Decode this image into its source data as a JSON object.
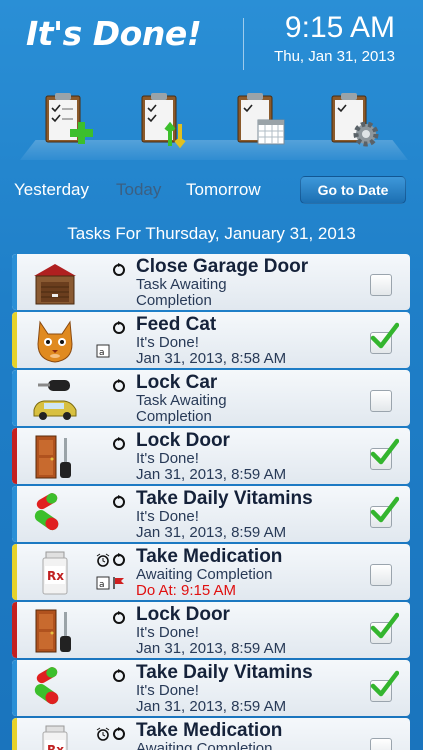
{
  "app": {
    "title": "It's Done!",
    "clock_time": "9:15 AM",
    "clock_date": "Thu, Jan 31, 2013"
  },
  "toolbar": {
    "icons": [
      "add-task-icon",
      "sort-tasks-icon",
      "calendar-tasks-icon",
      "settings-tasks-icon"
    ]
  },
  "daynav": {
    "yesterday": "Yesterday",
    "today": "Today",
    "tomorrow": "Tomorrow",
    "goto": "Go to Date"
  },
  "section_title": "Tasks For Thursday, January 31, 2013",
  "colors": {
    "accent_blue": "#2a8fd6",
    "accent_yellow": "#e6d22a",
    "accent_red": "#c42020",
    "due_red": "#e01010",
    "check_green": "#34b52e"
  },
  "tasks": [
    {
      "name": "Close Garage Door",
      "status": "Task Awaiting",
      "status2": "Completion",
      "due": "",
      "done": false,
      "accent": "#2a8fd6",
      "thumb": "garage-icon",
      "alarm": false,
      "note": false
    },
    {
      "name": "Feed Cat",
      "status": "It's Done!",
      "status2": "Jan 31, 2013, 8:58 AM",
      "due": "",
      "done": true,
      "accent": "#e6d22a",
      "thumb": "cat-icon",
      "alarm": false,
      "note": true
    },
    {
      "name": "Lock Car",
      "status": "Task Awaiting",
      "status2": "Completion",
      "due": "",
      "done": false,
      "accent": "#2a8fd6",
      "thumb": "car-key-icon",
      "alarm": false,
      "note": false
    },
    {
      "name": "Lock Door",
      "status": "It's Done!",
      "status2": "Jan 31, 2013, 8:59 AM",
      "due": "",
      "done": true,
      "accent": "#c42020",
      "thumb": "door-icon",
      "alarm": false,
      "note": false
    },
    {
      "name": "Take Daily Vitamins",
      "status": "It's Done!",
      "status2": "Jan 31, 2013, 8:59 AM",
      "due": "",
      "done": true,
      "accent": "#2a8fd6",
      "thumb": "pills-icon",
      "alarm": false,
      "note": false
    },
    {
      "name": "Take Medication",
      "status": "Awaiting Completion",
      "status2": "",
      "due": "Do At: 9:15 AM",
      "done": false,
      "accent": "#e6d22a",
      "thumb": "rx-bottle-icon",
      "alarm": true,
      "note": true
    },
    {
      "name": "Lock Door",
      "status": "It's Done!",
      "status2": "Jan 31, 2013, 8:59 AM",
      "due": "",
      "done": true,
      "accent": "#c42020",
      "thumb": "door-icon",
      "alarm": false,
      "note": false
    },
    {
      "name": "Take Daily Vitamins",
      "status": "It's Done!",
      "status2": "Jan 31, 2013, 8:59 AM",
      "due": "",
      "done": true,
      "accent": "#2a8fd6",
      "thumb": "pills-icon",
      "alarm": false,
      "note": false
    },
    {
      "name": "Take Medication",
      "status": "Awaiting Completion",
      "status2": "",
      "due": "",
      "done": false,
      "accent": "#e6d22a",
      "thumb": "rx-bottle-icon",
      "alarm": true,
      "note": false
    }
  ]
}
